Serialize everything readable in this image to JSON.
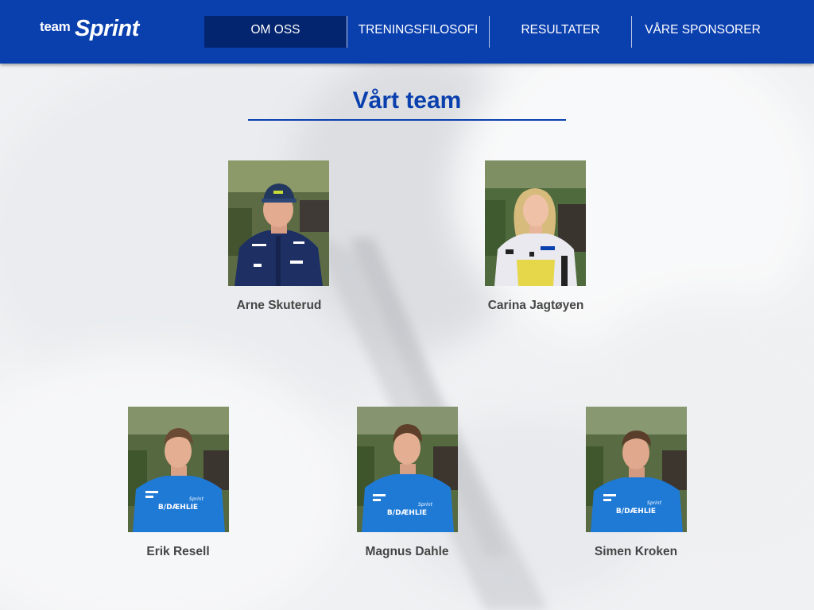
{
  "header": {
    "logo": {
      "small": "team",
      "big": "Sprint"
    },
    "nav": [
      {
        "label": "OM OSS",
        "active": true
      },
      {
        "label": "TRENINGSFILOSOFI",
        "active": false
      },
      {
        "label": "RESULTATER",
        "active": false
      },
      {
        "label": "VÅRE SPONSORER",
        "active": false
      }
    ]
  },
  "page": {
    "title": "Vårt team"
  },
  "members": [
    {
      "name": "Arne Skuterud",
      "jacket": "navy"
    },
    {
      "name": "Carina Jagtøyen",
      "jacket": "white-yellow"
    },
    {
      "name": "Erik Resell",
      "jacket": "blue"
    },
    {
      "name": "Magnus Dahle",
      "jacket": "blue"
    },
    {
      "name": "Simen Kroken",
      "jacket": "blue"
    }
  ],
  "colors": {
    "brand": "#0a3fae",
    "nav_active": "#03246e",
    "name_text": "#454545",
    "jersey": "#1f7ad6"
  },
  "jersey_print": {
    "brand": "B/DÆHLIE",
    "team": "Sprint"
  }
}
